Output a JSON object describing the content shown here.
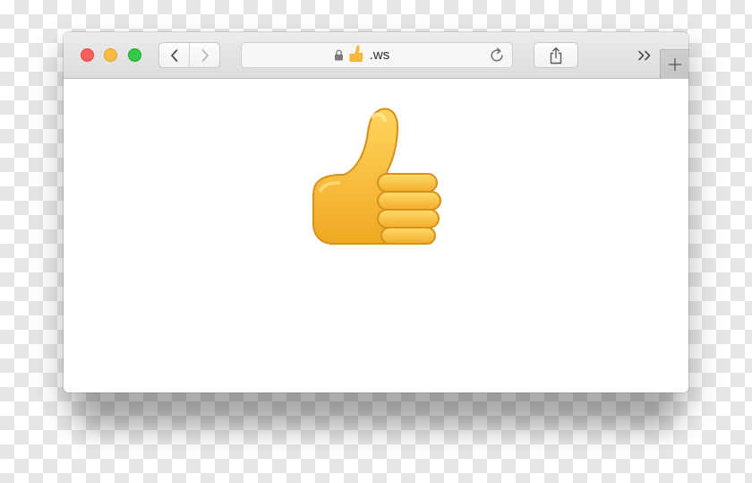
{
  "browser": {
    "toolbar": {
      "traffic_lights": {
        "close": {
          "icon": "close-traffic-light",
          "color": "#fc605c"
        },
        "minimize": {
          "icon": "minimize-traffic-light",
          "color": "#fdbc40"
        },
        "zoom": {
          "icon": "zoom-traffic-light",
          "color": "#34c84a"
        }
      },
      "back_icon": "chevron-left-icon",
      "forward_icon": "chevron-right-icon",
      "address": {
        "secure_icon": "lock-icon",
        "url_icon": "thumbs-up-icon",
        "url": ".ws",
        "reload_icon": "reload-icon"
      },
      "share_icon": "share-icon",
      "overflow_icon": "double-chevron-right-icon",
      "new_tab_icon": "plus-icon"
    },
    "content": {
      "image_icon": "thumbs-up-emoji",
      "background": "#ffffff"
    }
  }
}
